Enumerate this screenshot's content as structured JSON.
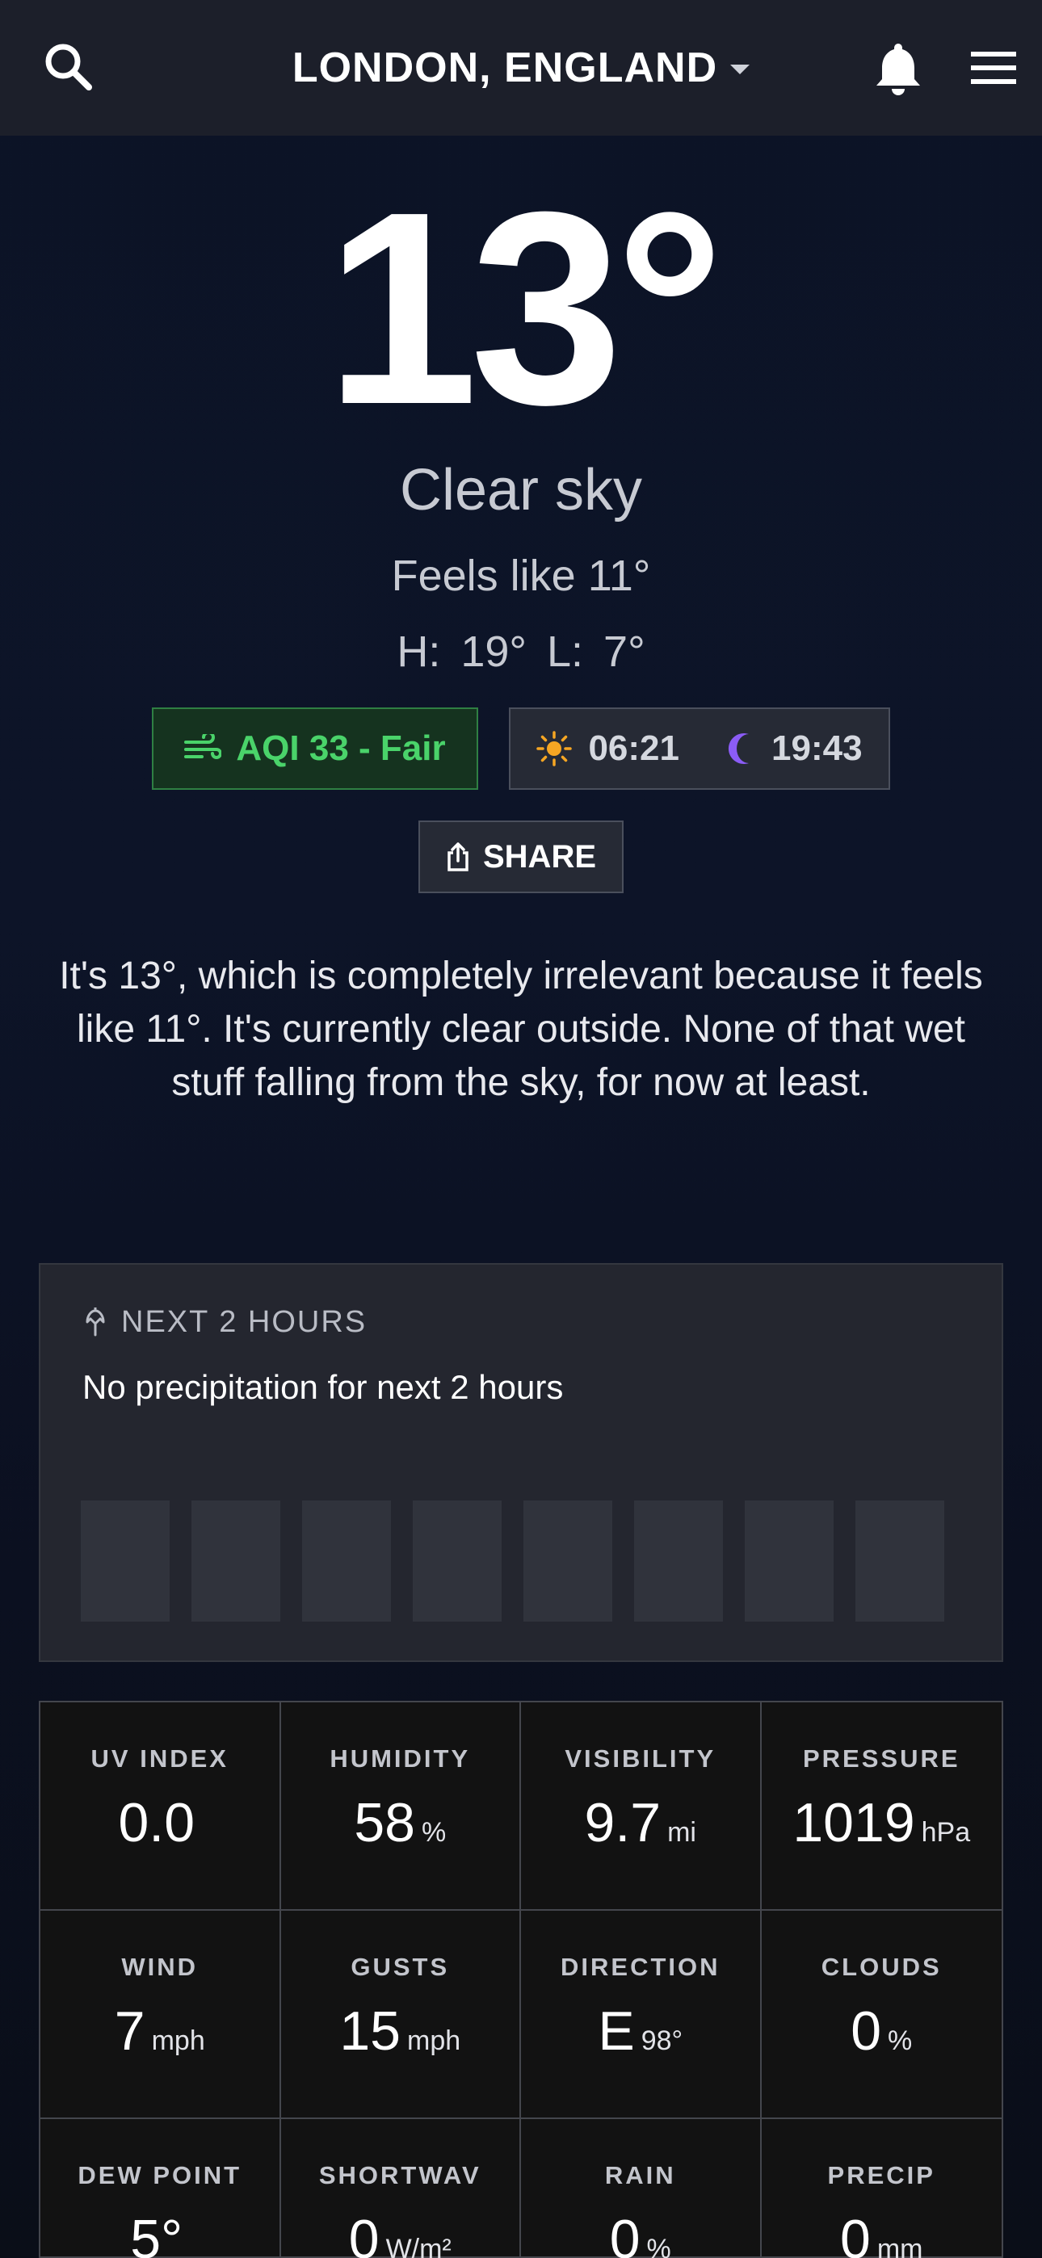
{
  "header": {
    "location": "LONDON, ENGLAND",
    "icons": {
      "search": "search-icon",
      "location_dropdown": "chevron-down-icon",
      "notifications": "bell-icon",
      "menu": "hamburger-icon"
    }
  },
  "current": {
    "temperature": "13°",
    "condition": "Clear sky",
    "feels_like": "Feels like 11°",
    "high_low": "H: 19°  L: 7°"
  },
  "badges": {
    "aqi": {
      "label": "AQI 33 - Fair",
      "icon": "wind-icon",
      "color": "#4ad36a"
    },
    "sunrise": {
      "time": "06:21",
      "icon": "sun-icon",
      "color": "#f6a623"
    },
    "sunset": {
      "time": "19:43",
      "icon": "moon-icon",
      "color": "#8b5cf6"
    }
  },
  "share": {
    "label": "SHARE",
    "icon": "share-icon"
  },
  "blurb": "It's 13°, which is completely irrelevant because it feels like 11°. It's currently clear outside. None of that wet stuff falling from the sky, for now at least.",
  "next_hours": {
    "title": "NEXT 2 HOURS",
    "icon": "umbrella-icon",
    "message": "No precipitation for next 2 hours",
    "bars": [
      0,
      0,
      0,
      0,
      0,
      0,
      0,
      0
    ]
  },
  "metrics": [
    {
      "label": "UV INDEX",
      "value": "0.0",
      "unit": ""
    },
    {
      "label": "HUMIDITY",
      "value": "58",
      "unit": "%"
    },
    {
      "label": "VISIBILITY",
      "value": "9.7",
      "unit": "mi"
    },
    {
      "label": "PRESSURE",
      "value": "1019",
      "unit": "hPa"
    },
    {
      "label": "WIND",
      "value": "7",
      "unit": "mph"
    },
    {
      "label": "GUSTS",
      "value": "15",
      "unit": "mph"
    },
    {
      "label": "DIRECTION",
      "value": "E",
      "unit": "98°"
    },
    {
      "label": "CLOUDS",
      "value": "0",
      "unit": "%"
    },
    {
      "label": "DEW POINT",
      "value": "5°",
      "unit": ""
    },
    {
      "label": "SHORTWAV",
      "value": "0",
      "unit": "W/m²"
    },
    {
      "label": "RAIN",
      "value": "0",
      "unit": "%"
    },
    {
      "label": "PRECIP",
      "value": "0",
      "unit": "mm"
    }
  ]
}
